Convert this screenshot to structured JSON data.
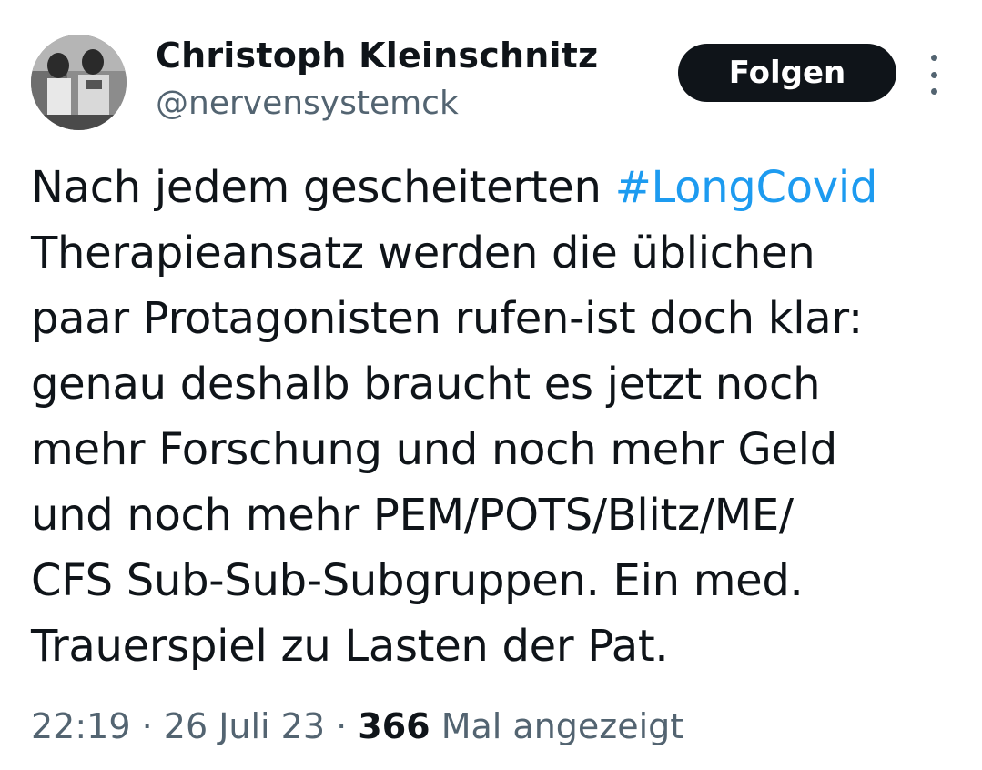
{
  "author": {
    "display_name": "Christoph Kleinschnitz",
    "handle": "@nervensystemck",
    "avatar_icon": "profile-photo"
  },
  "follow_button": {
    "label": "Folgen"
  },
  "more_menu": {
    "icon": "more-vertical-icon"
  },
  "tweet": {
    "lines": [
      {
        "before": "Nach jedem gescheiterten ",
        "hashtag": "#LongCovid"
      },
      {
        "text": "Therapieansatz werden die üblichen"
      },
      {
        "text": "paar Protagonisten rufen-ist doch klar:"
      },
      {
        "text": "genau deshalb braucht es jetzt noch"
      },
      {
        "text": "mehr Forschung und noch mehr Geld"
      },
      {
        "text": "und noch mehr PEM/POTS/Blitz/ME/"
      },
      {
        "text": "CFS Sub-Sub-Subgruppen. Ein med."
      },
      {
        "text": "Trauerspiel zu Lasten der Pat."
      }
    ]
  },
  "meta": {
    "time": "22:19",
    "separator": " · ",
    "date": "26 Juli 23",
    "views_count": "366",
    "views_label": " Mal angezeigt"
  },
  "colors": {
    "hashtag": "#1d9bf0",
    "secondary_text": "#536471",
    "button_bg": "#0f1419"
  }
}
